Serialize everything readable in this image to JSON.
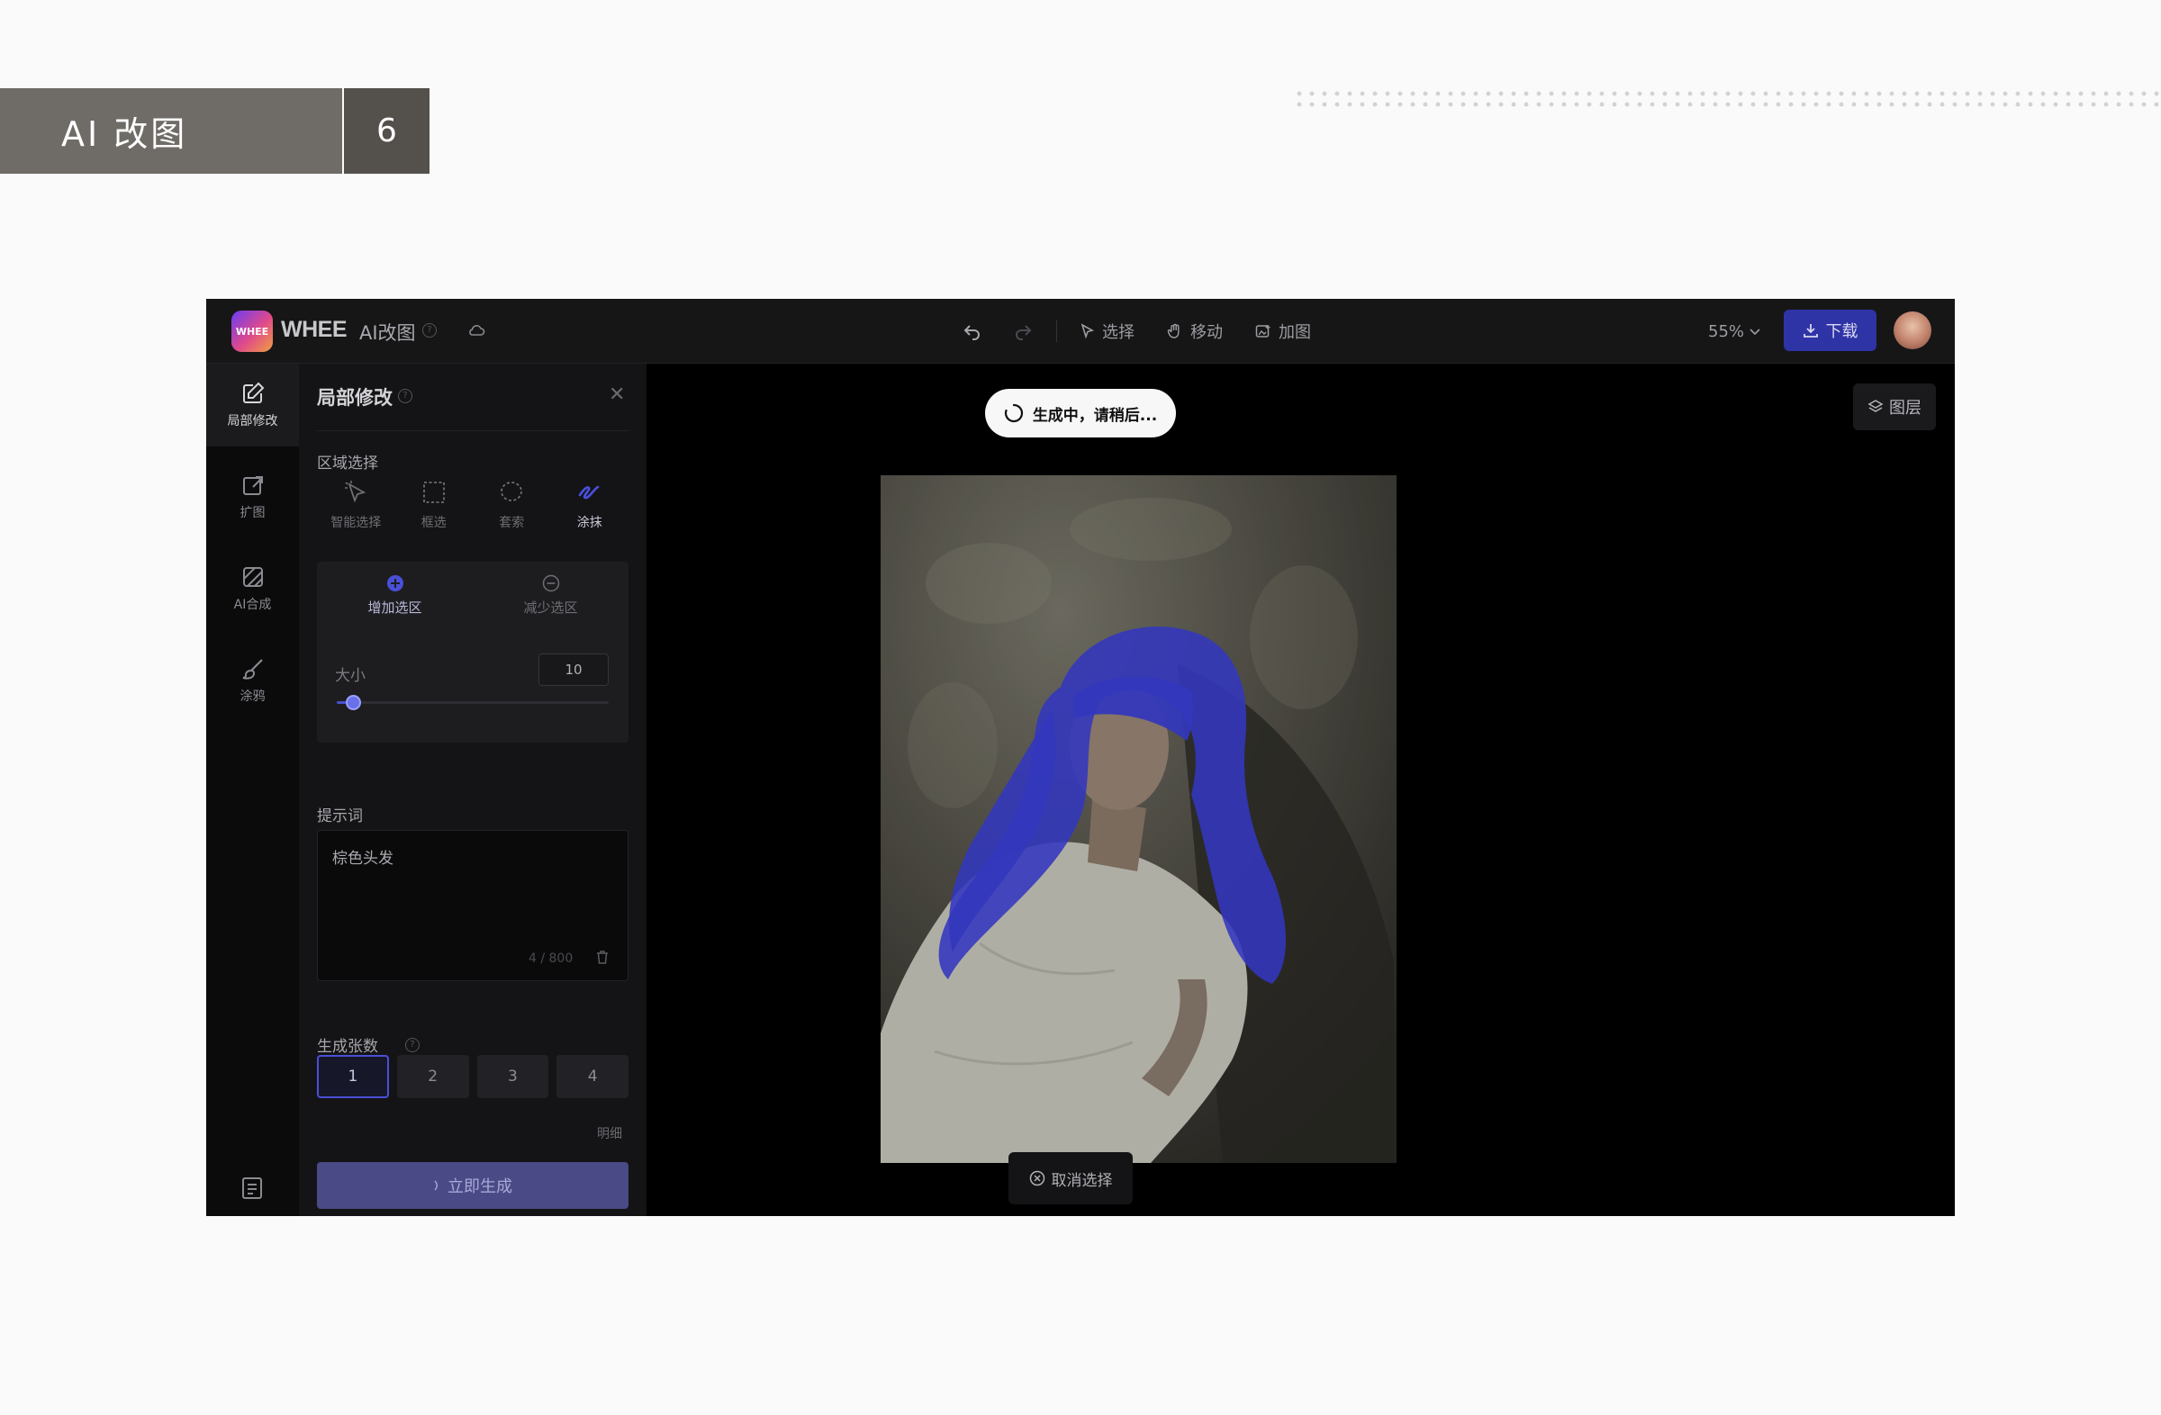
{
  "slide": {
    "title": "AI 改图",
    "page": "6"
  },
  "app": {
    "logo_text": "WHEE",
    "brand": "WHEE",
    "product": "AI改图",
    "toolbar": {
      "select": "选择",
      "move": "移动",
      "add_image": "加图"
    },
    "zoom": "55%",
    "download": "下载"
  },
  "rail": {
    "items": [
      {
        "label": "局部修改",
        "icon": "edit-icon"
      },
      {
        "label": "扩图",
        "icon": "expand-icon"
      },
      {
        "label": "AI合成",
        "icon": "compose-icon"
      },
      {
        "label": "涂鸦",
        "icon": "brush-icon"
      }
    ]
  },
  "panel": {
    "title": "局部修改",
    "region_label": "区域选择",
    "tools": [
      {
        "label": "智能选择",
        "icon": "smart-select-icon"
      },
      {
        "label": "框选",
        "icon": "rect-select-icon"
      },
      {
        "label": "套索",
        "icon": "lasso-icon"
      },
      {
        "label": "涂抹",
        "icon": "paint-icon",
        "active": true
      }
    ],
    "add_region": "增加选区",
    "reduce_region": "减少选区",
    "size_label": "大小",
    "size_value": "10",
    "size_slider_fraction": 0.06,
    "prompt_label": "提示词",
    "prompt_value": "棕色头发",
    "prompt_count": "4 / 800",
    "count_label": "生成张数",
    "counts": [
      "1",
      "2",
      "3",
      "4"
    ],
    "selected_count": "1",
    "detail": "明细",
    "generate": "立即生成"
  },
  "canvas": {
    "toast": "生成中，请稍后...",
    "layers": "图层",
    "cancel": "取消选择"
  },
  "colors": {
    "accent": "#2e33a6",
    "mask": "#3a3fd8"
  }
}
